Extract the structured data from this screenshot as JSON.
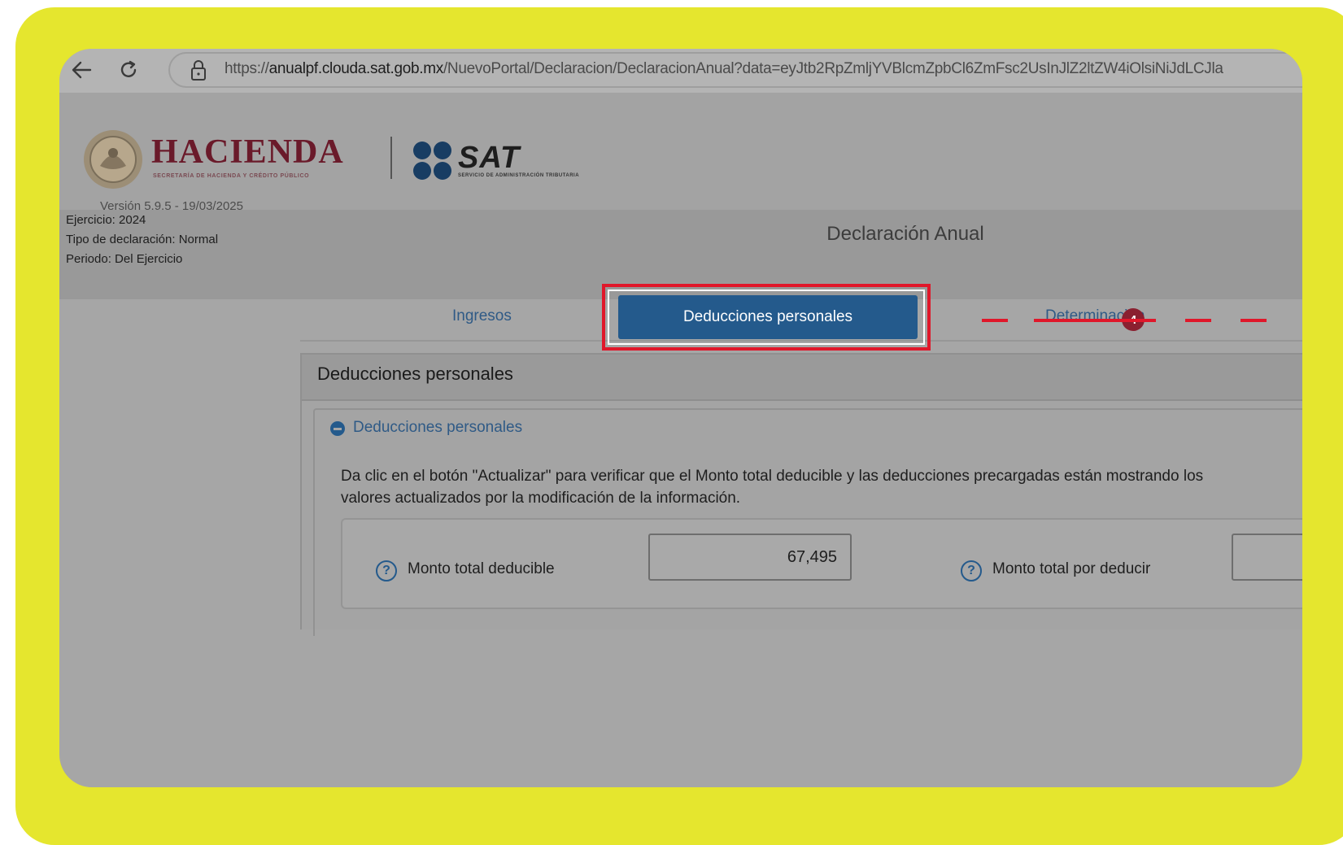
{
  "browser": {
    "url_prefix": "https://",
    "url_host": "anualpf.clouda.sat.gob.mx",
    "url_path": "/NuevoPortal/Declaracion/DeclaracionAnual?data=eyJtb2RpZmljYVBlcmZpbCl6ZmFsc2UsInJlZ2ltZW4iOlsiNiJdLCJla"
  },
  "header": {
    "hacienda_label": "HACIENDA",
    "hacienda_subtitle": "SECRETARÍA DE HACIENDA Y CRÉDITO PÚBLICO",
    "sat_label": "SAT",
    "sat_subtitle": "SERVICIO DE ADMINISTRACIÓN TRIBUTARIA"
  },
  "info": {
    "version": "Versión 5.9.5 - 19/03/2025",
    "ejercicio": "Ejercicio: 2024",
    "tipo": "Tipo de declaración: Normal",
    "periodo": "Periodo: Del Ejercicio",
    "page_title": "Declaración Anual"
  },
  "tabs": {
    "ingresos": "Ingresos",
    "deducciones": "Deducciones personales",
    "determinacion": "Determinación",
    "determinacion_badge": "4"
  },
  "panel": {
    "title": "Deducciones personales",
    "section_title": "Deducciones personales",
    "instructions": "Da clic en el botón \"Actualizar\" para verificar que el Monto total deducible y las deducciones precargadas están mostrando los valores actualizados por la modificación de la información.",
    "monto_deducible_label": "Monto total deducible",
    "monto_deducible_value": "67,495",
    "monto_por_deducir_label": "Monto total por deducir"
  },
  "colors": {
    "frame": "#e5e62e",
    "active_tab": "#245a8c",
    "highlight": "#e0172a"
  }
}
